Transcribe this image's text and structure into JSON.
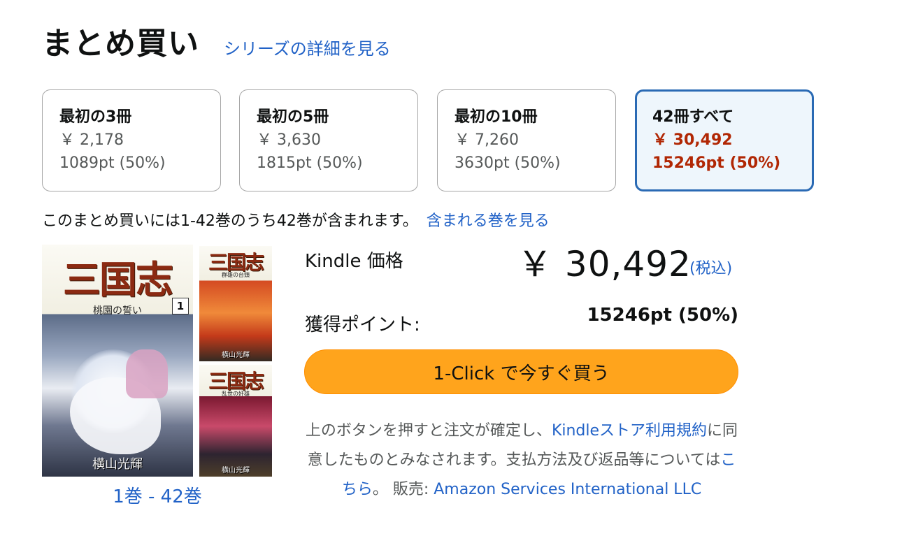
{
  "header": {
    "title": "まとめ買い",
    "series_link": "シリーズの詳細を見る"
  },
  "options": [
    {
      "title": "最初の3冊",
      "price": "￥ 2,178",
      "points": "1089pt (50%)",
      "selected": false
    },
    {
      "title": "最初の5冊",
      "price": "￥ 3,630",
      "points": "1815pt (50%)",
      "selected": false
    },
    {
      "title": "最初の10冊",
      "price": "￥ 7,260",
      "points": "3630pt (50%)",
      "selected": false
    },
    {
      "title": "42冊すべて",
      "price": "￥ 30,492",
      "points": "15246pt (50%)",
      "selected": true
    }
  ],
  "contains": {
    "text": "このまとめ買いには1-42巻のうち42巻が含まれます。",
    "link": "含まれる巻を見る"
  },
  "covers": {
    "main": {
      "title": "三国志",
      "subtitle": "桃園の誓い",
      "volume": "1",
      "author": "横山光輝"
    },
    "small1": {
      "title": "三国志",
      "subtitle": "群雄の台頭",
      "author": "横山光輝"
    },
    "small2": {
      "title": "三国志",
      "subtitle": "乱世の奸雄",
      "author": "横山光輝"
    }
  },
  "volume_range": "1巻 - 42巻",
  "price": {
    "label": "Kindle 価格",
    "value": "￥ 30,492",
    "tax_link": "(税込)"
  },
  "points": {
    "label": "獲得ポイント:",
    "value": "15246pt (50%)"
  },
  "buy_button": "1-Click で今すぐ買う",
  "terms": {
    "text1": "上のボタンを押すと注文が確定し、",
    "link1": "Kindleストア利用規約",
    "text2": "に同意したものとみなされます。支払方法及び返品等については",
    "link2": "こちら",
    "text3": "。 販売: ",
    "seller": "Amazon Services International LLC"
  },
  "colors": {
    "link": "#2162c7",
    "price_red": "#b12704",
    "buy_button": "#ffa41c",
    "selected_border": "#2a6ab4"
  }
}
